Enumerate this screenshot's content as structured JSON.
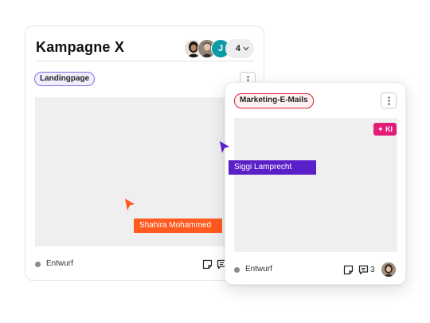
{
  "card_campaign": {
    "title": "Kampagne X",
    "member_count": "4",
    "member_initial": "J",
    "tag": "Landingpage",
    "status": "Entwurf"
  },
  "card_email": {
    "tag": "Marketing-E-Mails",
    "ai_badge": "✦ KI",
    "status": "Entwurf",
    "comment_count": "3"
  },
  "cursors": [
    {
      "name": "Shahira Mohammed",
      "color": "#ff5a1f"
    },
    {
      "name": "Siggi Lamprecht",
      "color": "#5a1fc9"
    }
  ],
  "colors": {
    "tag_landingpage_border": "#7d6fe0",
    "tag_mail_border": "#d61e36",
    "ai_badge": "#e31c79",
    "status_dot": "#8a8a8f",
    "avatar_teal": "#0e9aa6"
  },
  "icons": [
    "chevron-down-icon",
    "kebab-menu-icon",
    "note-icon",
    "comment-icon",
    "cursor-icon",
    "sparkle-icon"
  ]
}
